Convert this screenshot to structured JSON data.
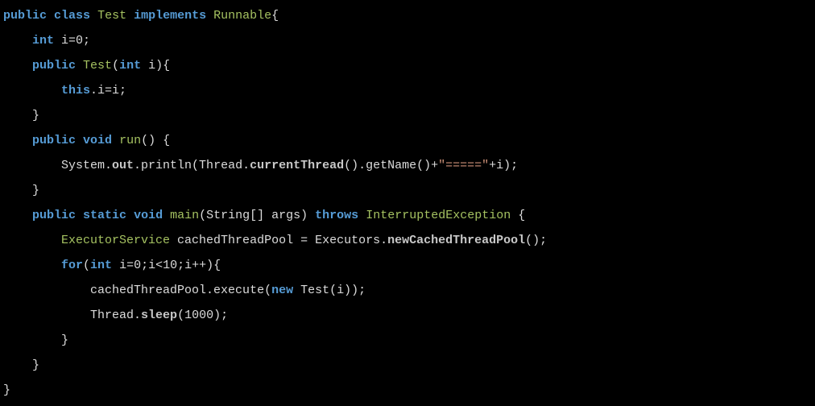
{
  "code": {
    "l1": {
      "kw_public": "public",
      "kw_class": "class",
      "name": "Test",
      "kw_impl": "implements",
      "iface": "Runnable",
      "brace": "{"
    },
    "l2": {
      "indent": "    ",
      "kw_int": "int",
      "decl": " i=0;"
    },
    "l3": {
      "indent": "    ",
      "kw_public": "public",
      "name": "Test",
      "sig": "(",
      "kw_int": "int",
      "sig2": " i){"
    },
    "l4": {
      "indent": "        ",
      "kw_this": "this",
      "rest": ".i=i;"
    },
    "l5": {
      "indent": "    ",
      "brace": "}"
    },
    "l6": {
      "indent": "    ",
      "kw_public": "public",
      "kw_void": "void",
      "name": "run",
      "sig": "() {"
    },
    "l7": {
      "indent": "        ",
      "p1": "System.",
      "out": "out",
      "p2": ".println(Thread.",
      "ct": "currentThread",
      "p3": "().getName()+",
      "str": "\"=====\"",
      "p4": "+i);"
    },
    "l8": {
      "indent": "    ",
      "brace": "}"
    },
    "l9": {
      "indent": "    ",
      "kw_public": "public",
      "kw_static": "static",
      "kw_void": "void",
      "name": "main",
      "p1": "(String[] args) ",
      "kw_throws": "throws",
      "exc": "InterruptedException",
      "p2": " {"
    },
    "l10": {
      "indent": "        ",
      "type": "ExecutorService",
      "var": " cachedThreadPool = Executors.",
      "m": "newCachedThreadPool",
      "end": "();"
    },
    "l11": {
      "indent": "        ",
      "kw_for": "for",
      "p1": "(",
      "kw_int": "int",
      "p2": " i=0;i<10;i++){"
    },
    "l12": {
      "indent": "            ",
      "p1": "cachedThreadPool.execute(",
      "kw_new": "new",
      "p2": " Test(i));"
    },
    "l13": {
      "indent": "            ",
      "p1": "Thread.",
      "m": "sleep",
      "p2": "(1000);"
    },
    "l14": {
      "indent": "        ",
      "brace": "}"
    },
    "l15": {
      "indent": "    ",
      "brace": "}"
    },
    "l16": {
      "brace": "}"
    }
  }
}
